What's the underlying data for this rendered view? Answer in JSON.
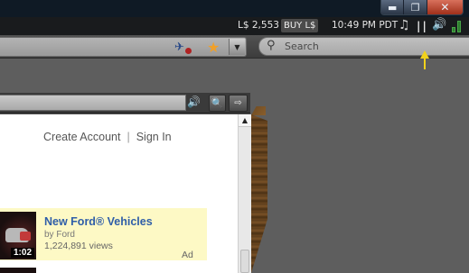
{
  "window": {
    "minimize_glyph": "▬",
    "restore_glyph": "❐",
    "close_glyph": "✕"
  },
  "statusbar": {
    "balance": "L$ 2,553",
    "buy_label": "BUY L$",
    "time": "10:49 PM PDT",
    "icons": {
      "music": "♫",
      "pause": "| |",
      "volume": "🔊"
    }
  },
  "navbar": {
    "search_placeholder": "Search",
    "icons": {
      "gesture": "✈",
      "star": "★",
      "dropdown": "▼",
      "search": "⚲"
    }
  },
  "floater": {
    "icons": {
      "volume": "🔊",
      "zoom": "🔍",
      "popout": "⇨"
    }
  },
  "webpage": {
    "header": {
      "create_account": "Create Account",
      "separator": "|",
      "sign_in": "Sign In"
    },
    "ad": {
      "title": "New Ford® Vehicles",
      "by": "by Ford",
      "views": "1,224,891 views",
      "label": "Ad",
      "duration": "1:02"
    },
    "scroll_up_glyph": "▲"
  },
  "colors": {
    "accent_link": "#2f5ea8",
    "ad_background": "#fdf9c5",
    "annotation_arrow": "#f2d21b",
    "star": "#f0a02a"
  }
}
